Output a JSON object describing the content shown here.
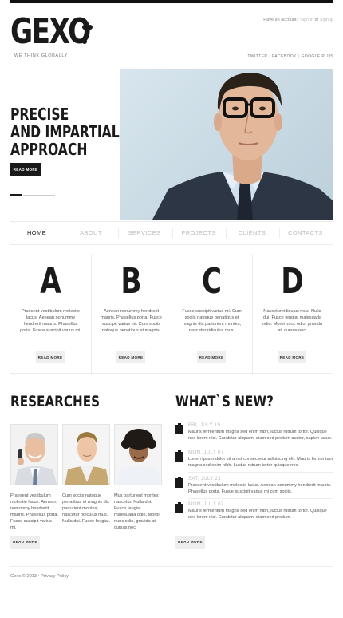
{
  "header": {
    "logo": "GEXO",
    "tagline": "WE THINK GLOBALLY",
    "account_prompt": "Have an account?",
    "signin": "Sign in",
    "or": "or",
    "signup": "Signup",
    "social": [
      "TWITTER",
      "FACEBOOK",
      "GOOGLE PLUS"
    ]
  },
  "hero": {
    "title_lines": [
      "PRECISE",
      "AND IMPARTIAL",
      "APPROACH"
    ],
    "button": "READ MORE"
  },
  "nav": {
    "items": [
      "HOME",
      "ABOUT",
      "SERVICES",
      "PROJECTS",
      "CLIENTS",
      "CONTACTS"
    ],
    "active": "HOME"
  },
  "features": [
    {
      "letter": "A",
      "text": "Praesent vestibulum molestie lacus. Aenean nonummy hendrerit mauris. Phasellus porta. Fusce suscipit varius mi.",
      "button": "READ MORE"
    },
    {
      "letter": "B",
      "text": "Aenean nonummy hendrerit mauris. Phasellus porta. Fusce suscipit varius mi. Cum sociis natoque penatibus et magnis.",
      "button": "READ MORE"
    },
    {
      "letter": "C",
      "text": "Fusce suscipit varius mi. Cum sociis natoque penatibus et magnis dis parturient montes, nascetur ridiculus mus.",
      "button": "READ MORE"
    },
    {
      "letter": "D",
      "text": "Nascetur ridiculus mus. Nulla dui. Fusce feugiat malesuada odio. Morbi nunc odio, gravida at, cursus nec.",
      "button": "READ MORE"
    }
  ],
  "researches": {
    "title": "RESEARCHES",
    "items": [
      {
        "text": "Praesent vestibulum molestie lacus. Aenean nonummy hendrerit mauris. Phasellus porta. Fusce suscipit varius mi."
      },
      {
        "text": "Cum sociis natoque penatibus et magnis dis parturient montes, nascetur ridiculus mus. Nulla dui. Fusce feugiat."
      },
      {
        "text": "Mus parturient montes nascetur. Nulla dui. Fusce feugiat malesuada odio. Morbi nunc odio, gravida at, cursus nec."
      }
    ],
    "button": "READ MORE"
  },
  "news": {
    "title": "WHAT`S NEW?",
    "items": [
      {
        "date": "FRI, JULY 19",
        "text": "Mauris fermentum magna sed enim nibh, luctus rutrum tortor. Quisque nec lorem nisl. Curabitur aliquam, diam sed pretium auctor, sapien lacus."
      },
      {
        "date": "MON, JULY 07",
        "text": "Lorem ipsum dolor sit amet consectetur adipiscing elit. Mauris fermentum magna sed enim nibh. Luctus rutrum tortor quisque nec."
      },
      {
        "date": "SAT, JULY 21",
        "text": "Praesent vestibulum molestie lacus. Aenean nonummy hendrerit mauris. Phasellus porta. Fusce suscipit varius mi cum sociis."
      },
      {
        "date": "MON, JULY 07",
        "text": "Mauris fermentum magna sed enim nibh, luctus rutrum tortor. Quisque nec lorem nisl. Curabitur aliquam, diam sed pretium."
      }
    ],
    "button": "READ MORE"
  },
  "footer": {
    "text": "Gexo © 2013 • Privacy Policy"
  }
}
